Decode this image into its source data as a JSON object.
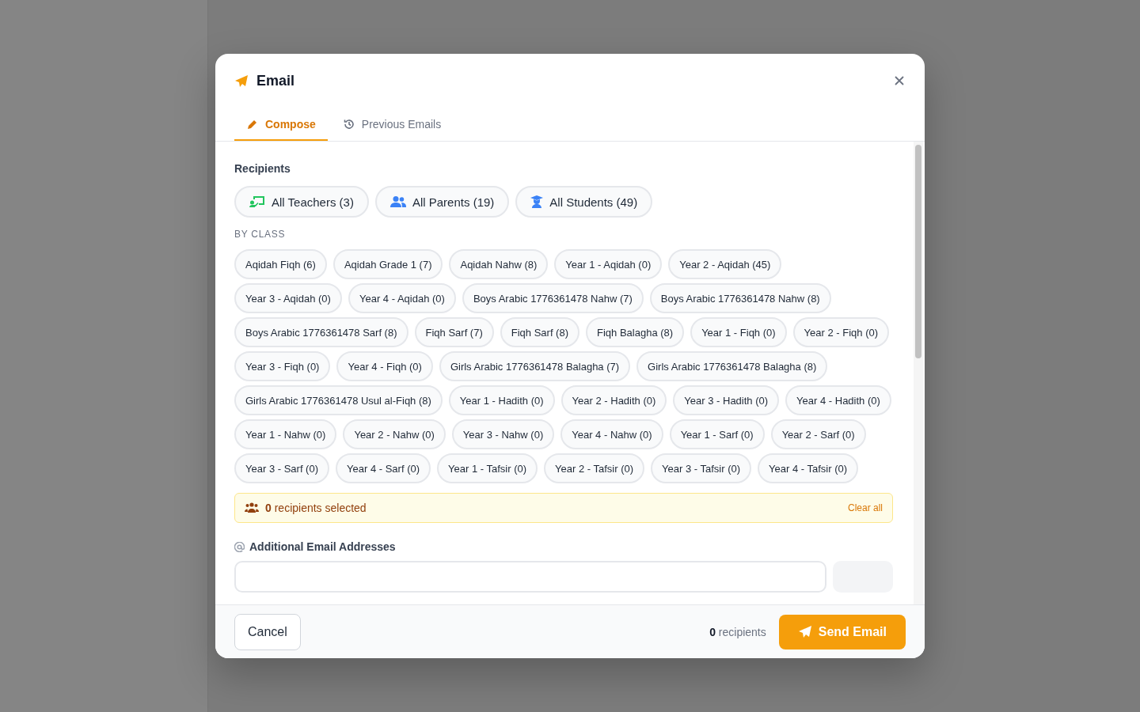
{
  "dialog": {
    "title": "Email",
    "tabs": [
      {
        "label": "Compose",
        "selected": true
      },
      {
        "label": "Previous Emails",
        "selected": false
      }
    ],
    "recipients_label": "Recipients",
    "groups": [
      {
        "label": "All Teachers (3)",
        "selected": false
      },
      {
        "label": "All Parents (19)",
        "selected": false
      },
      {
        "label": "All Students (49)",
        "selected": false
      }
    ],
    "by_class_label": "BY CLASS",
    "classes": [
      {
        "label": "Aqidah Fiqh (6)",
        "selected": false
      },
      {
        "label": "Aqidah Grade 1 (7)",
        "selected": false
      },
      {
        "label": "Aqidah Nahw (8)",
        "selected": false
      },
      {
        "label": "Year 1 - Aqidah (0)",
        "selected": false
      },
      {
        "label": "Year 2 - Aqidah (45)",
        "selected": false
      },
      {
        "label": "Year 3 - Aqidah (0)",
        "selected": false
      },
      {
        "label": "Year 4 - Aqidah (0)",
        "selected": false
      },
      {
        "label": "Boys Arabic 1776361478 Nahw (7)",
        "selected": false
      },
      {
        "label": "Boys Arabic 1776361478 Nahw (8)",
        "selected": false
      },
      {
        "label": "Boys Arabic 1776361478 Sarf (8)",
        "selected": false
      },
      {
        "label": "Fiqh Sarf (7)",
        "selected": false
      },
      {
        "label": "Fiqh Sarf (8)",
        "selected": false
      },
      {
        "label": "Fiqh Balagha (8)",
        "selected": false
      },
      {
        "label": "Year 1 - Fiqh (0)",
        "selected": false
      },
      {
        "label": "Year 2 - Fiqh (0)",
        "selected": false
      },
      {
        "label": "Year 3 - Fiqh (0)",
        "selected": false
      },
      {
        "label": "Year 4 - Fiqh (0)",
        "selected": false
      },
      {
        "label": "Girls Arabic 1776361478 Balagha (7)",
        "selected": false
      },
      {
        "label": "Girls Arabic 1776361478 Balagha (8)",
        "selected": false
      },
      {
        "label": "Girls Arabic 1776361478 Usul al-Fiqh (8)",
        "selected": false
      },
      {
        "label": "Year 1 - Hadith (0)",
        "selected": false
      },
      {
        "label": "Year 2 - Hadith (0)",
        "selected": false
      },
      {
        "label": "Year 3 - Hadith (0)",
        "selected": false
      },
      {
        "label": "Year 4 - Hadith (0)",
        "selected": false
      },
      {
        "label": "Year 1 - Nahw (0)",
        "selected": false
      },
      {
        "label": "Year 2 - Nahw (0)",
        "selected": false
      },
      {
        "label": "Year 3 - Nahw (0)",
        "selected": false
      },
      {
        "label": "Year 4 - Nahw (0)",
        "selected": false
      },
      {
        "label": "Year 1 - Sarf (0)",
        "selected": false
      },
      {
        "label": "Year 2 - Sarf (0)",
        "selected": false
      },
      {
        "label": "Year 3 - Sarf (0)",
        "selected": false
      },
      {
        "label": "Year 4 - Sarf (0)",
        "selected": false
      },
      {
        "label": "Year 1 - Tafsir (0)",
        "selected": false
      },
      {
        "label": "Year 2 - Tafsir (0)",
        "selected": false
      },
      {
        "label": "Year 3 - Tafsir (0)",
        "selected": false
      },
      {
        "label": "Year 4 - Tafsir (0)",
        "selected": false
      }
    ],
    "summary": {
      "text": "**0** recipients selected",
      "clear": "Clear all"
    },
    "additional_label": "Additional Email Addresses",
    "footer": {
      "cancel": "Cancel",
      "count": "**0** recipients",
      "send": "Send Email"
    }
  }
}
